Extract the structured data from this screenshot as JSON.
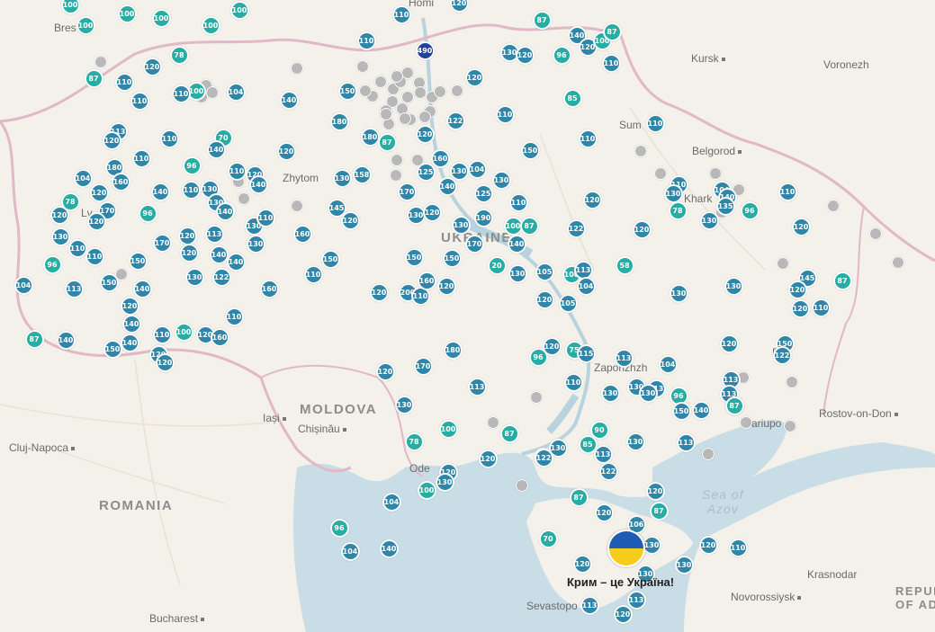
{
  "colors": {
    "blue": "#2f86a8",
    "teal": "#27ada4",
    "grey": "#b8b8b8",
    "navy": "#24409a",
    "land": "#f4f1ea",
    "water": "#c9dde7"
  },
  "labels": {
    "homel": "Homi",
    "brest": "Bres",
    "kursk": "Kursk",
    "voronezh": "Voronezh",
    "sumy": "Sum",
    "belgorod": "Belgorod",
    "kharkiv": "Khark",
    "zhytomyr": "Zhytom",
    "lviv": "Lv",
    "ukraine": "UKRAINE",
    "moldova": "MOLDOVA",
    "iasi": "Iași",
    "chisinau": "Chișinău",
    "cluj": "Cluj-Napoca",
    "romania": "ROMANIA",
    "odesa": "Ode",
    "zaporizhzhia": "Zaporizhzh",
    "mariupol": "ariupo",
    "donetsk": "Do",
    "rostov": "Rostov-on-Don",
    "sea_of_azov_1": "Sea of",
    "sea_of_azov_2": "Azov",
    "krasnodar": "Krasnodar",
    "novorossiysk": "Novorossiysk",
    "sevastopol": "Sevastopo",
    "bucharest": "Bucharest",
    "republic_1": "REPUB",
    "republic_2": "OF ADY",
    "crimea": "Крим – це Україна!"
  },
  "markers": [
    {
      "v": "100",
      "c": "teal"
    },
    {
      "v": "100",
      "c": "teal"
    },
    {
      "v": "100",
      "c": "teal"
    },
    {
      "v": "100",
      "c": "teal"
    },
    {
      "v": "100",
      "c": "teal"
    },
    {
      "v": "100",
      "c": "teal"
    },
    {
      "v": "110",
      "c": "blue"
    },
    {
      "v": "120",
      "c": "blue"
    },
    {
      "v": "87",
      "c": "teal"
    },
    {
      "v": "490",
      "c": "navy"
    },
    {
      "v": "140",
      "c": "blue"
    },
    {
      "v": "120",
      "c": "blue"
    },
    {
      "v": "100",
      "c": "teal"
    },
    {
      "v": "87",
      "c": "teal"
    },
    {
      "v": "130",
      "c": "blue"
    },
    {
      "v": "120",
      "c": "blue"
    },
    {
      "v": "96",
      "c": "teal"
    },
    {
      "v": "110",
      "c": "blue"
    },
    {
      "v": "78",
      "c": "teal"
    },
    {
      "v": "120",
      "c": "blue"
    },
    {
      "v": "87",
      "c": "teal"
    },
    {
      "v": "110",
      "c": "blue"
    },
    {
      "v": "110",
      "c": "blue"
    },
    {
      "v": "100",
      "c": "teal"
    },
    {
      "v": "104",
      "c": "blue"
    },
    {
      "v": "140",
      "c": "blue"
    },
    {
      "v": "150",
      "c": "blue"
    },
    {
      "v": "110",
      "c": "blue"
    },
    {
      "v": "120",
      "c": "blue"
    },
    {
      "v": "110",
      "c": "blue"
    },
    {
      "v": "85",
      "c": "teal"
    },
    {
      "v": "122",
      "c": "blue"
    },
    {
      "v": "110",
      "c": "blue"
    },
    {
      "v": "180",
      "c": "blue"
    },
    {
      "v": "110",
      "c": "blue"
    },
    {
      "v": "113",
      "c": "blue"
    },
    {
      "v": "120",
      "c": "blue"
    },
    {
      "v": "110",
      "c": "blue"
    },
    {
      "v": "70",
      "c": "teal"
    },
    {
      "v": "140",
      "c": "blue"
    },
    {
      "v": "120",
      "c": "blue"
    },
    {
      "v": "180",
      "c": "blue"
    },
    {
      "v": "87",
      "c": "teal"
    },
    {
      "v": "120",
      "c": "blue"
    },
    {
      "v": "150",
      "c": "blue"
    },
    {
      "v": "110",
      "c": "blue"
    },
    {
      "v": "110",
      "c": "blue"
    },
    {
      "v": "96",
      "c": "teal"
    },
    {
      "v": "180",
      "c": "blue"
    },
    {
      "v": "104",
      "c": "blue"
    },
    {
      "v": "160",
      "c": "blue"
    },
    {
      "v": "120",
      "c": "blue"
    },
    {
      "v": "140",
      "c": "blue"
    },
    {
      "v": "110",
      "c": "blue"
    },
    {
      "v": "130",
      "c": "blue"
    },
    {
      "v": "110",
      "c": "blue"
    },
    {
      "v": "120",
      "c": "blue"
    },
    {
      "v": "140",
      "c": "blue"
    },
    {
      "v": "130",
      "c": "blue"
    },
    {
      "v": "130",
      "c": "blue"
    },
    {
      "v": "158",
      "c": "blue"
    },
    {
      "v": "160",
      "c": "blue"
    },
    {
      "v": "125",
      "c": "blue"
    },
    {
      "v": "130",
      "c": "blue"
    },
    {
      "v": "104",
      "c": "blue"
    },
    {
      "v": "130",
      "c": "blue"
    },
    {
      "v": "78",
      "c": "teal"
    },
    {
      "v": "110",
      "c": "blue"
    },
    {
      "v": "130",
      "c": "blue"
    },
    {
      "v": "104",
      "c": "blue"
    },
    {
      "v": "110",
      "c": "blue"
    },
    {
      "v": "140",
      "c": "blue"
    },
    {
      "v": "135",
      "c": "blue"
    },
    {
      "v": "125",
      "c": "blue"
    },
    {
      "v": "170",
      "c": "blue"
    },
    {
      "v": "140",
      "c": "blue"
    },
    {
      "v": "110",
      "c": "blue"
    },
    {
      "v": "120",
      "c": "blue"
    },
    {
      "v": "120",
      "c": "blue"
    },
    {
      "v": "170",
      "c": "blue"
    },
    {
      "v": "120",
      "c": "blue"
    },
    {
      "v": "96",
      "c": "teal"
    },
    {
      "v": "130",
      "c": "blue"
    },
    {
      "v": "140",
      "c": "blue"
    },
    {
      "v": "130",
      "c": "blue"
    },
    {
      "v": "110",
      "c": "blue"
    },
    {
      "v": "145",
      "c": "blue"
    },
    {
      "v": "130",
      "c": "blue"
    },
    {
      "v": "120",
      "c": "blue"
    },
    {
      "v": "190",
      "c": "blue"
    },
    {
      "v": "130",
      "c": "blue"
    },
    {
      "v": "100",
      "c": "teal"
    },
    {
      "v": "87",
      "c": "teal"
    },
    {
      "v": "122",
      "c": "blue"
    },
    {
      "v": "120",
      "c": "blue"
    },
    {
      "v": "130",
      "c": "blue"
    },
    {
      "v": "96",
      "c": "teal"
    },
    {
      "v": "78",
      "c": "teal"
    },
    {
      "v": "120",
      "c": "blue"
    },
    {
      "v": "130",
      "c": "blue"
    },
    {
      "v": "110",
      "c": "blue"
    },
    {
      "v": "170",
      "c": "blue"
    },
    {
      "v": "110",
      "c": "blue"
    },
    {
      "v": "120",
      "c": "blue"
    },
    {
      "v": "113",
      "c": "blue"
    },
    {
      "v": "120",
      "c": "blue"
    },
    {
      "v": "140",
      "c": "blue"
    },
    {
      "v": "130",
      "c": "blue"
    },
    {
      "v": "120",
      "c": "blue"
    },
    {
      "v": "160",
      "c": "blue"
    },
    {
      "v": "150",
      "c": "blue"
    },
    {
      "v": "140",
      "c": "blue"
    },
    {
      "v": "110",
      "c": "blue"
    },
    {
      "v": "150",
      "c": "blue"
    },
    {
      "v": "150",
      "c": "blue"
    },
    {
      "v": "150",
      "c": "blue"
    },
    {
      "v": "170",
      "c": "blue"
    },
    {
      "v": "140",
      "c": "blue"
    },
    {
      "v": "20",
      "c": "teal"
    },
    {
      "v": "130",
      "c": "blue"
    },
    {
      "v": "105",
      "c": "blue"
    },
    {
      "v": "100",
      "c": "teal"
    },
    {
      "v": "113",
      "c": "blue"
    },
    {
      "v": "58",
      "c": "teal"
    },
    {
      "v": "145",
      "c": "blue"
    },
    {
      "v": "87",
      "c": "teal"
    },
    {
      "v": "104",
      "c": "blue"
    },
    {
      "v": "96",
      "c": "teal"
    },
    {
      "v": "113",
      "c": "blue"
    },
    {
      "v": "150",
      "c": "blue"
    },
    {
      "v": "140",
      "c": "blue"
    },
    {
      "v": "120",
      "c": "blue"
    },
    {
      "v": "130",
      "c": "blue"
    },
    {
      "v": "122",
      "c": "blue"
    },
    {
      "v": "160",
      "c": "blue"
    },
    {
      "v": "120",
      "c": "blue"
    },
    {
      "v": "200",
      "c": "blue"
    },
    {
      "v": "110",
      "c": "blue"
    },
    {
      "v": "120",
      "c": "blue"
    },
    {
      "v": "160",
      "c": "blue"
    },
    {
      "v": "120",
      "c": "blue"
    },
    {
      "v": "105",
      "c": "blue"
    },
    {
      "v": "104",
      "c": "blue"
    },
    {
      "v": "130",
      "c": "blue"
    },
    {
      "v": "130",
      "c": "blue"
    },
    {
      "v": "120",
      "c": "blue"
    },
    {
      "v": "120",
      "c": "blue"
    },
    {
      "v": "110",
      "c": "blue"
    },
    {
      "v": "140",
      "c": "blue"
    },
    {
      "v": "87",
      "c": "teal"
    },
    {
      "v": "140",
      "c": "blue"
    },
    {
      "v": "150",
      "c": "blue"
    },
    {
      "v": "140",
      "c": "blue"
    },
    {
      "v": "110",
      "c": "blue"
    },
    {
      "v": "100",
      "c": "teal"
    },
    {
      "v": "120",
      "c": "blue"
    },
    {
      "v": "110",
      "c": "blue"
    },
    {
      "v": "160",
      "c": "blue"
    },
    {
      "v": "120",
      "c": "blue"
    },
    {
      "v": "75",
      "c": "teal"
    },
    {
      "v": "115",
      "c": "blue"
    },
    {
      "v": "120",
      "c": "blue"
    },
    {
      "v": "150",
      "c": "blue"
    },
    {
      "v": "122",
      "c": "blue"
    },
    {
      "v": "120",
      "c": "blue"
    },
    {
      "v": "120",
      "c": "blue"
    },
    {
      "v": "120",
      "c": "blue"
    },
    {
      "v": "170",
      "c": "blue"
    },
    {
      "v": "180",
      "c": "blue"
    },
    {
      "v": "113",
      "c": "blue"
    },
    {
      "v": "96",
      "c": "teal"
    },
    {
      "v": "113",
      "c": "blue"
    },
    {
      "v": "104",
      "c": "blue"
    },
    {
      "v": "130",
      "c": "blue"
    },
    {
      "v": "113",
      "c": "blue"
    },
    {
      "v": "110",
      "c": "blue"
    },
    {
      "v": "130",
      "c": "blue"
    },
    {
      "v": "130",
      "c": "blue"
    },
    {
      "v": "113",
      "c": "blue"
    },
    {
      "v": "113",
      "c": "blue"
    },
    {
      "v": "130",
      "c": "blue"
    },
    {
      "v": "96",
      "c": "teal"
    },
    {
      "v": "150",
      "c": "blue"
    },
    {
      "v": "140",
      "c": "blue"
    },
    {
      "v": "100",
      "c": "teal"
    },
    {
      "v": "87",
      "c": "teal"
    },
    {
      "v": "120",
      "c": "blue"
    },
    {
      "v": "78",
      "c": "teal"
    },
    {
      "v": "100",
      "c": "teal"
    },
    {
      "v": "87",
      "c": "teal"
    },
    {
      "v": "85",
      "c": "teal"
    },
    {
      "v": "113",
      "c": "blue"
    },
    {
      "v": "130",
      "c": "blue"
    },
    {
      "v": "113",
      "c": "blue"
    },
    {
      "v": "130",
      "c": "blue"
    },
    {
      "v": "90",
      "c": "teal"
    },
    {
      "v": "120",
      "c": "blue"
    },
    {
      "v": "120",
      "c": "blue"
    },
    {
      "v": "122",
      "c": "blue"
    },
    {
      "v": "130",
      "c": "blue"
    },
    {
      "v": "122",
      "c": "blue"
    },
    {
      "v": "104",
      "c": "blue"
    },
    {
      "v": "100",
      "c": "teal"
    },
    {
      "v": "87",
      "c": "teal"
    },
    {
      "v": "120",
      "c": "blue"
    },
    {
      "v": "87",
      "c": "teal"
    },
    {
      "v": "120",
      "c": "blue"
    },
    {
      "v": "96",
      "c": "teal"
    },
    {
      "v": "104",
      "c": "blue"
    },
    {
      "v": "140",
      "c": "blue"
    },
    {
      "v": "70",
      "c": "teal"
    },
    {
      "v": "106",
      "c": "blue"
    },
    {
      "v": "130",
      "c": "blue"
    },
    {
      "v": "120",
      "c": "blue"
    },
    {
      "v": "110",
      "c": "blue"
    },
    {
      "v": "120",
      "c": "blue"
    },
    {
      "v": "130",
      "c": "blue"
    },
    {
      "v": "130",
      "c": "blue"
    },
    {
      "v": "113",
      "c": "blue"
    },
    {
      "v": "113",
      "c": "blue"
    },
    {
      "v": "120",
      "c": "blue"
    },
    {
      "v": "87",
      "c": "teal"
    },
    {
      "v": "90",
      "c": "teal"
    },
    {
      "v": "122",
      "c": "blue"
    },
    {
      "v": "140",
      "c": "blue"
    },
    {
      "v": "78",
      "c": "teal"
    },
    {
      "v": "110",
      "c": "blue"
    },
    {
      "v": "113",
      "c": "blue"
    },
    {
      "v": "125",
      "c": "blue"
    },
    {
      "v": "87",
      "c": "teal"
    },
    {
      "v": "110",
      "c": "blue"
    },
    {
      "v": "100",
      "c": "teal"
    },
    {
      "v": "110",
      "c": "blue"
    },
    {
      "v": "90",
      "c": "teal"
    },
    {
      "v": "110",
      "c": "blue"
    },
    {
      "v": "100",
      "c": "teal"
    },
    {
      "v": "120",
      "c": "blue"
    },
    {
      "v": "100",
      "c": "teal"
    },
    {
      "v": "100",
      "c": "teal"
    },
    {
      "v": "120",
      "c": "blue"
    },
    {
      "v": "110",
      "c": "blue"
    }
  ]
}
